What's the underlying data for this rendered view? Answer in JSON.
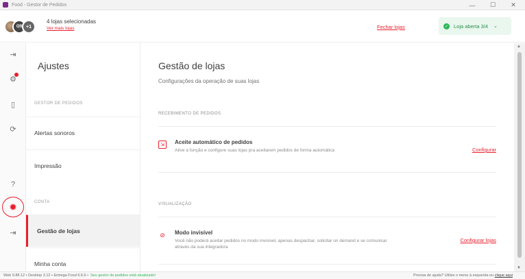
{
  "window": {
    "title": "Food - Gestor de Pedidos",
    "controls": [
      "—",
      "☐",
      "✕"
    ]
  },
  "colors": {
    "brand": "#ea1d2c",
    "status_open": "#2fb757",
    "app_icon": "#7a2a8a"
  },
  "header": {
    "avatar_count": "+1",
    "avatar_initial": "Ofi",
    "stores_selected": "4 lojas selecionadas",
    "see_more": "Ver mais lojas",
    "close_stores": "Fechar lojas",
    "store_status": "Loja aberta 3/4",
    "status_check": "✓",
    "chevron": "⌄"
  },
  "rail": {
    "icons": [
      "logout-icon",
      "orders-icon",
      "clipboard-icon",
      "refresh-icon",
      "help-icon",
      "settings-icon",
      "exit-icon"
    ],
    "glyphs": {
      "logout": "⇥",
      "orders": "⚙",
      "clipboard": "▯",
      "refresh": "⟳",
      "help": "?",
      "settings": "✹",
      "exit": "⇥"
    }
  },
  "settings_nav": {
    "heading": "Ajustes",
    "section_orders": "GESTOR DE PEDIDOS",
    "item_sound": "Alertas sonoros",
    "item_print": "Impressão",
    "section_account": "CONTA",
    "item_stores": "Gestão de lojas",
    "item_account": "Minha conta"
  },
  "main": {
    "title": "Gestão de lojas",
    "subtitle": "Configurações da operação de suas lojas",
    "section_receiving": "RECEBIMENTO DE PEDIDOS",
    "auto_accept": {
      "icon": "⇲",
      "title": "Aceite automático de pedidos",
      "description": "Ative a função e configure suas lojas pra aceitarem pedidos de forma automática",
      "link": "Configurar"
    },
    "section_view": "VISUALIZAÇÃO",
    "invisible": {
      "icon": "⊘",
      "title": "Modo invisível",
      "description": "Você não poderá aceitar pedidos no modo invisível, apenas despachar, solicitar on demand e se comunicar através da sua integradora",
      "link": "Configurar lojas"
    }
  },
  "statusbar": {
    "version": "Web 9.88.12 • Desktop 3.12 • Entrega Food 6.6.6 •",
    "updated": "Seu gestor de pedidos está atualizado!",
    "help_text": "Precisa de ajuda? Utilize o menu à esquerda ou",
    "help_link": "clique aqui"
  },
  "scrollbar": {
    "up": "▲",
    "down": "▼"
  }
}
